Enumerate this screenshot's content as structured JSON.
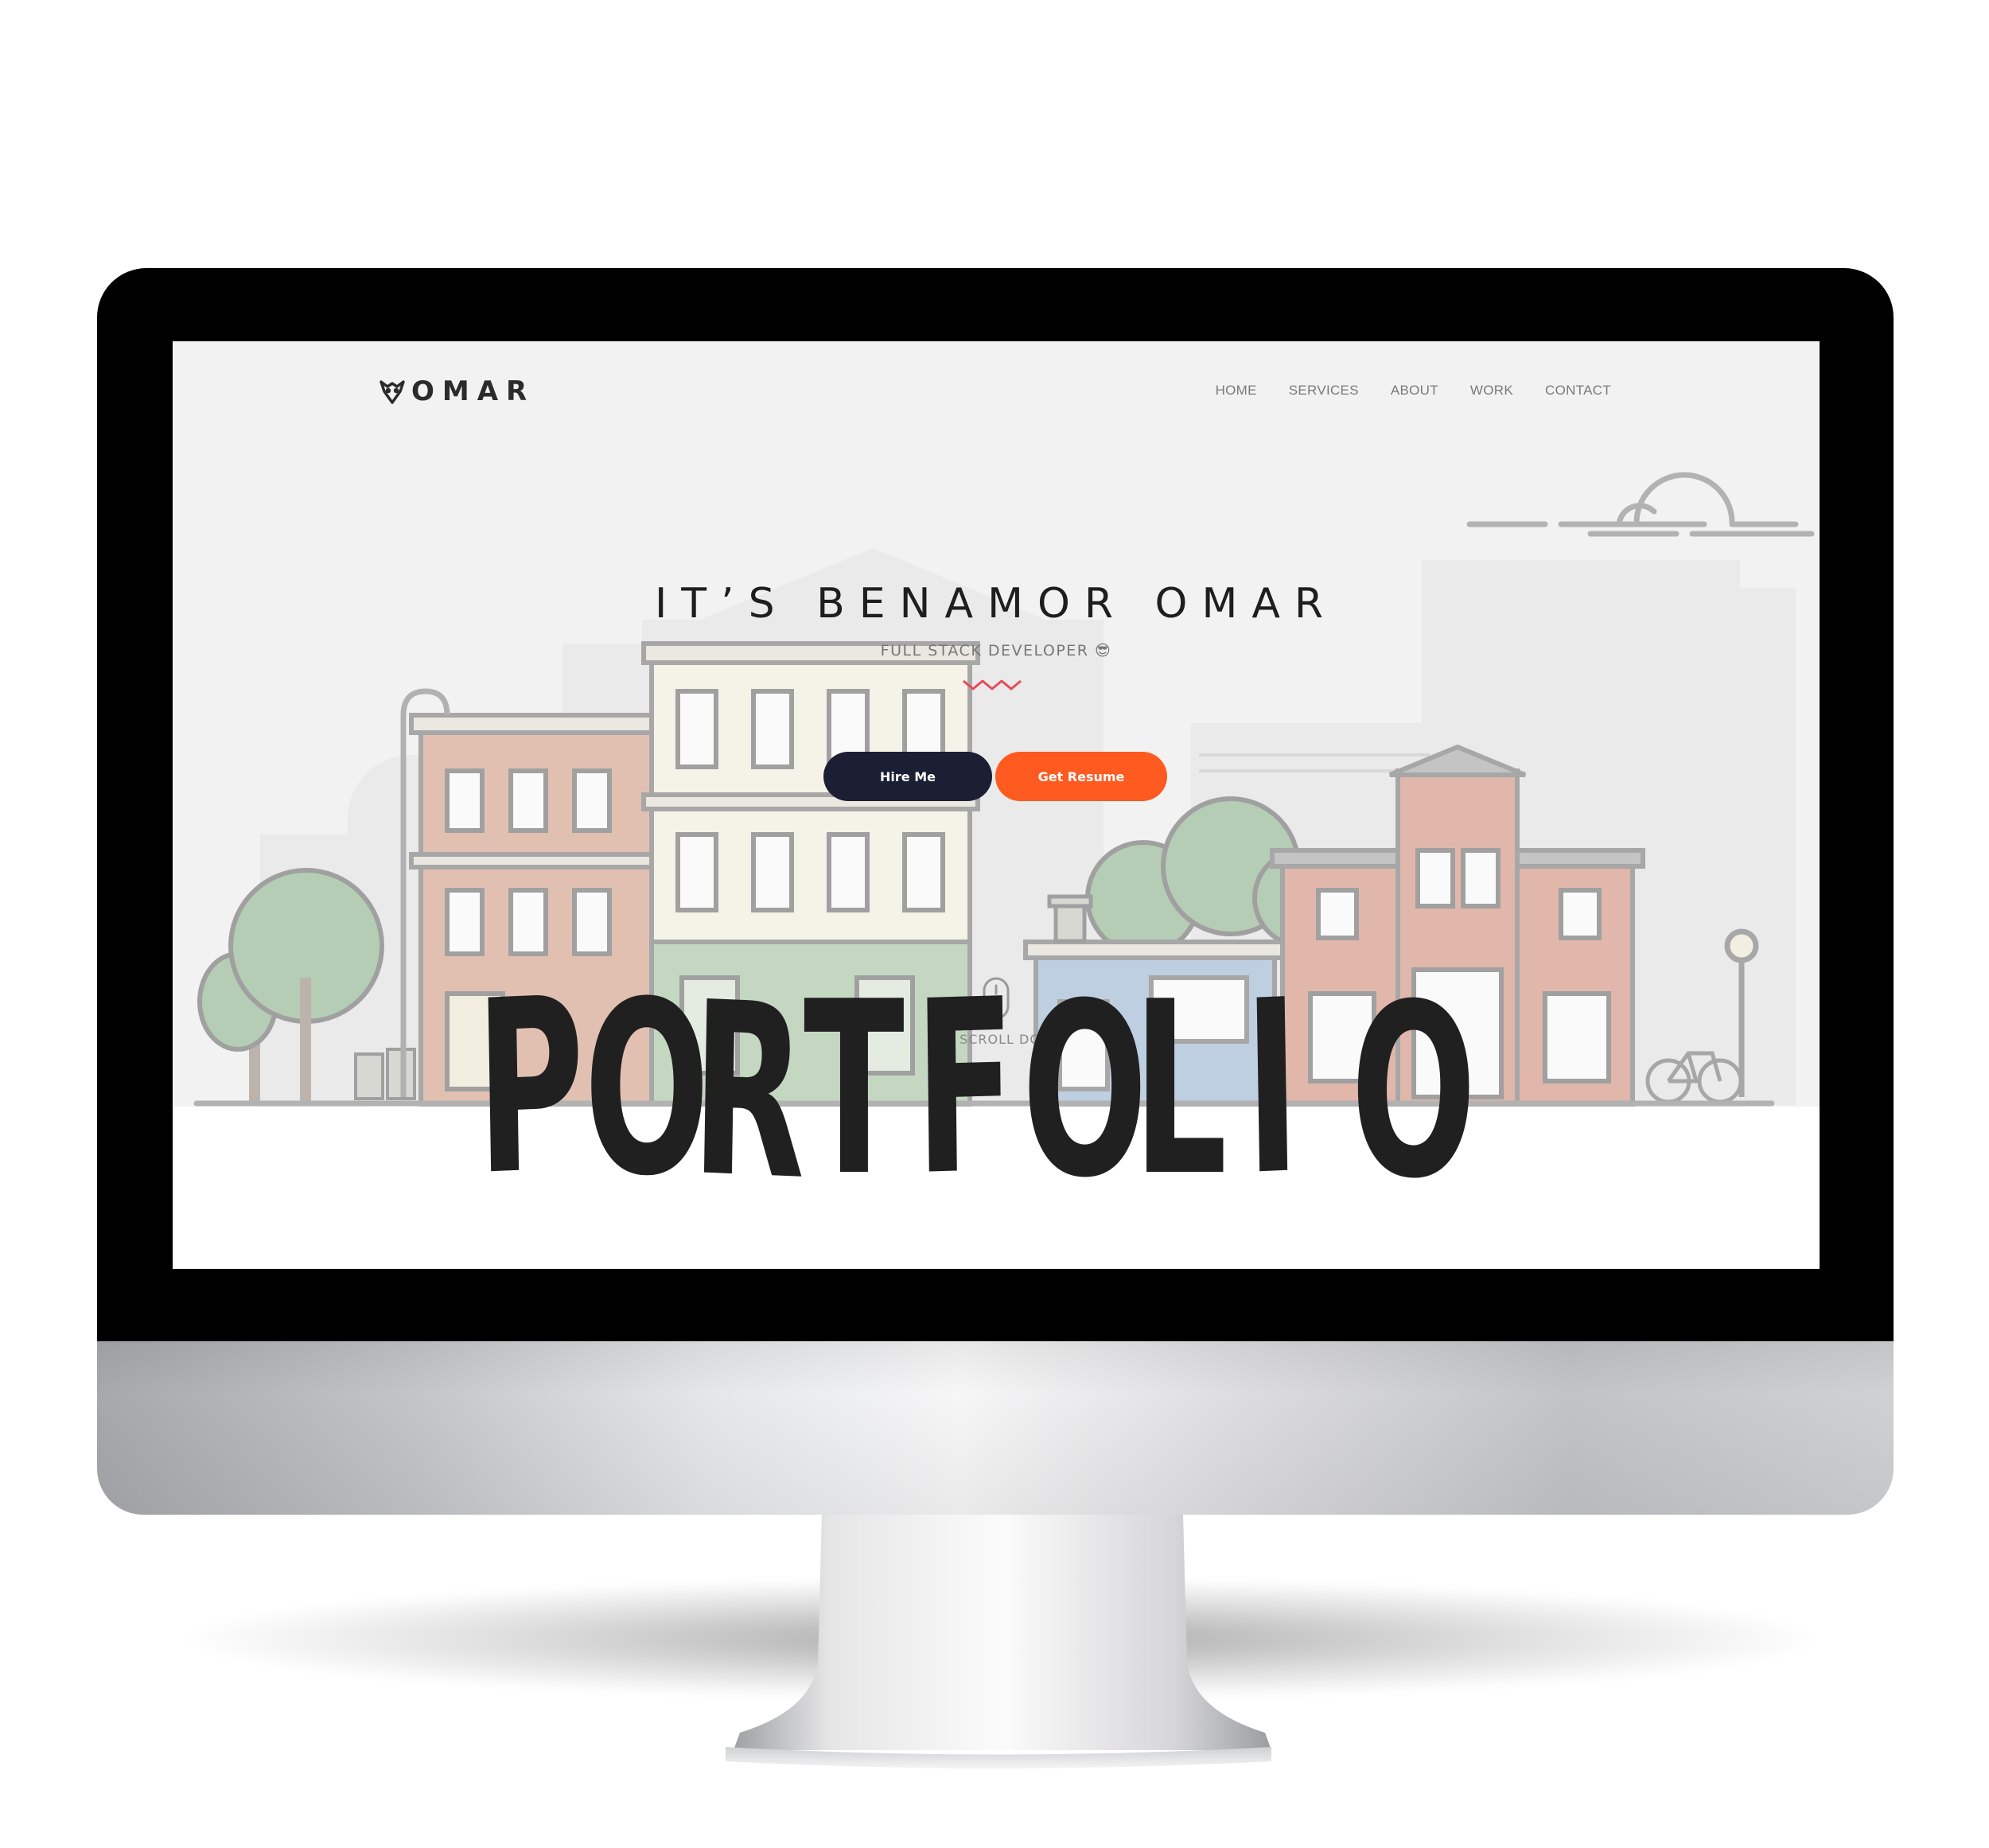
{
  "website": {
    "brand": {
      "logo_icon": "owl-logo-icon",
      "name": "OMAR"
    },
    "nav": [
      {
        "label": "HOME"
      },
      {
        "label": "SERVICES"
      },
      {
        "label": "ABOUT"
      },
      {
        "label": "WORK"
      },
      {
        "label": "CONTACT"
      }
    ],
    "hero": {
      "title": "IT’S BENAMOR OMAR",
      "subtitle": "FULL STACK DEVELOPER 😎",
      "hire_button": "Hire Me",
      "resume_button": "Get Resume",
      "scroll_label": "SCROLL DO"
    }
  },
  "overlay": {
    "word": "PORTFOLIO"
  },
  "colors": {
    "hire_button": "#1c1f33",
    "resume_button": "#ff5a1f",
    "squiggle_accent": "#e8495c",
    "screen_background": "#f2f2f2"
  }
}
